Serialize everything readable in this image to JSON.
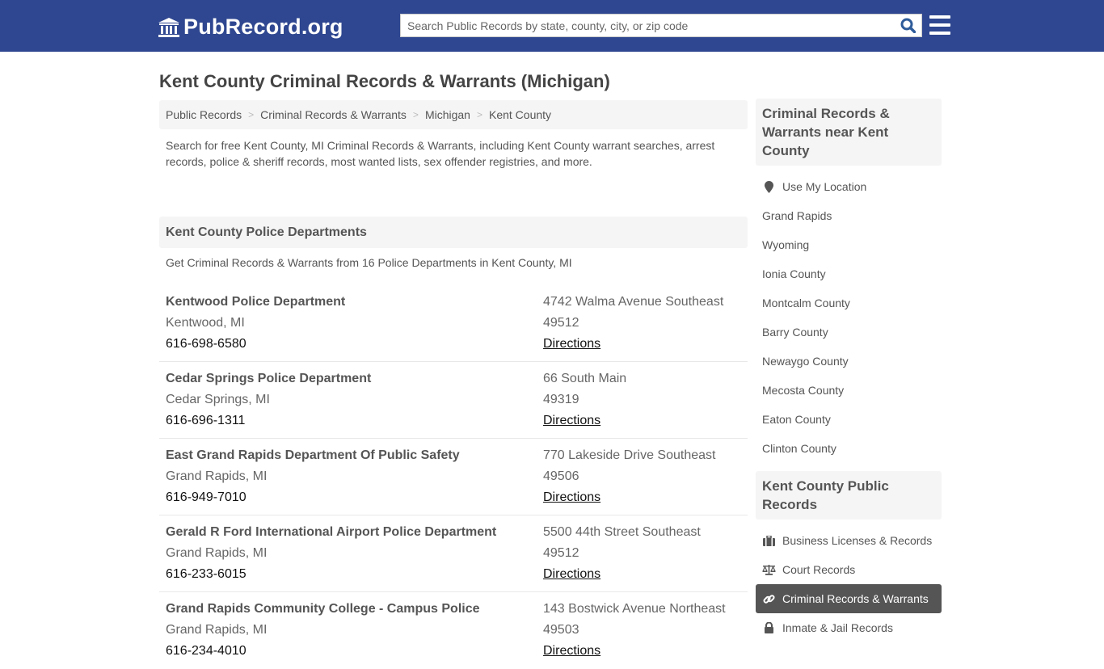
{
  "header": {
    "logo_text": "PubRecord.org",
    "search_placeholder": "Search Public Records by state, county, city, or zip code",
    "brand_color": "#2f4790"
  },
  "page_title": "Kent County Criminal Records & Warrants (Michigan)",
  "breadcrumb": [
    "Public Records",
    "Criminal Records & Warrants",
    "Michigan",
    "Kent County"
  ],
  "intro": "Search for free Kent County, MI Criminal Records & Warrants, including Kent County warrant searches, arrest records, police & sheriff records, most wanted lists, sex offender registries, and more.",
  "section": {
    "title": "Kent County Police Departments",
    "subtitle": "Get Criminal Records & Warrants from 16 Police Departments in Kent County, MI"
  },
  "departments": [
    {
      "name": "Kentwood Police Department",
      "city": "Kentwood, MI",
      "phone": "616-698-6580",
      "address": "4742 Walma Avenue Southeast",
      "zip": "49512",
      "directions": "Directions"
    },
    {
      "name": "Cedar Springs Police Department",
      "city": "Cedar Springs, MI",
      "phone": "616-696-1311",
      "address": "66 South Main",
      "zip": "49319",
      "directions": "Directions"
    },
    {
      "name": "East Grand Rapids Department Of Public Safety",
      "city": "Grand Rapids, MI",
      "phone": "616-949-7010",
      "address": "770 Lakeside Drive Southeast",
      "zip": "49506",
      "directions": "Directions"
    },
    {
      "name": "Gerald R Ford International Airport Police Department",
      "city": "Grand Rapids, MI",
      "phone": "616-233-6015",
      "address": "5500 44th Street Southeast",
      "zip": "49512",
      "directions": "Directions"
    },
    {
      "name": "Grand Rapids Community College - Campus Police",
      "city": "Grand Rapids, MI",
      "phone": "616-234-4010",
      "address": "143 Bostwick Avenue Northeast",
      "zip": "49503",
      "directions": "Directions"
    }
  ],
  "sidebar": {
    "nearby_title": "Criminal Records & Warrants near Kent County",
    "use_location": "Use My Location",
    "nearby": [
      "Grand Rapids",
      "Wyoming",
      "Ionia County",
      "Montcalm County",
      "Barry County",
      "Newaygo County",
      "Mecosta County",
      "Eaton County",
      "Clinton County"
    ],
    "public_title": "Kent County Public Records",
    "public_items": [
      {
        "label": "Business Licenses & Records",
        "icon": "briefcase-icon",
        "active": false
      },
      {
        "label": "Court Records",
        "icon": "scale-icon",
        "active": false
      },
      {
        "label": "Criminal Records & Warrants",
        "icon": "link-icon",
        "active": true
      },
      {
        "label": "Inmate & Jail Records",
        "icon": "lock-icon",
        "active": false
      }
    ]
  }
}
